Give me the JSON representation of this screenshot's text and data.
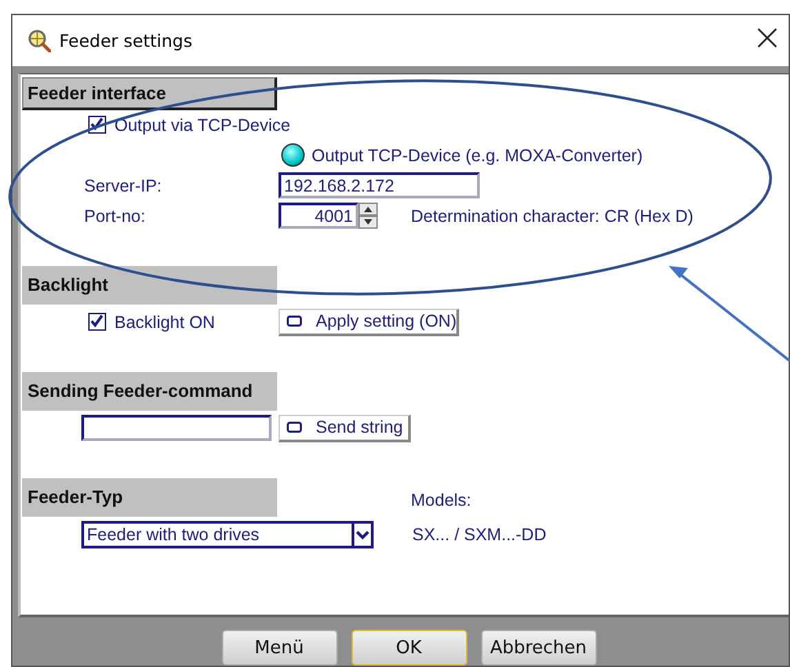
{
  "window": {
    "title": "Feeder settings"
  },
  "sections": [
    {
      "title": "Feeder interface",
      "focused": true,
      "lines": [
        {
          "left": {
            "kind": "checkbox",
            "label": "Output via TCP-Device",
            "checked": true
          }
        },
        {
          "middle": {
            "kind": "indicator",
            "label": "Output TCP-Device (e.g. MOXA-Converter)",
            "on": true
          }
        },
        {
          "left": {
            "kind": "label",
            "text": "Server-IP:"
          },
          "middle": {
            "kind": "field",
            "value": "192.168.2.172"
          }
        },
        {
          "left": {
            "kind": "label",
            "text": "Port-no:"
          },
          "middle": {
            "kind": "spin",
            "value": "4001"
          },
          "right": {
            "kind": "label",
            "text": "Determination character: CR (Hex D)"
          }
        }
      ]
    },
    {
      "title": "Backlight",
      "focused": false,
      "lines": [
        {
          "left": {
            "kind": "checkbox",
            "label": "Backlight ON",
            "checked": true
          },
          "middle": {
            "kind": "button",
            "label": "Apply setting (ON)"
          }
        }
      ]
    },
    {
      "title": "Sending Feeder-command",
      "focused": false,
      "lines": [
        {
          "left": {
            "kind": "field"
          },
          "middle": {
            "kind": "button",
            "label": "Send string"
          }
        }
      ]
    },
    {
      "title": "Feeder-Typ",
      "focused": false,
      "note": "Models:",
      "lines": [
        {
          "left": {
            "kind": "select",
            "value": "Feeder with two drives"
          },
          "right": {
            "kind": "label",
            "text": "SX...  /  SXM...-DD"
          }
        }
      ]
    }
  ],
  "buttons": [
    {
      "label": "Menü",
      "default": false
    },
    {
      "label": "OK",
      "default": true
    },
    {
      "label": "Abbrechen",
      "default": false
    }
  ]
}
